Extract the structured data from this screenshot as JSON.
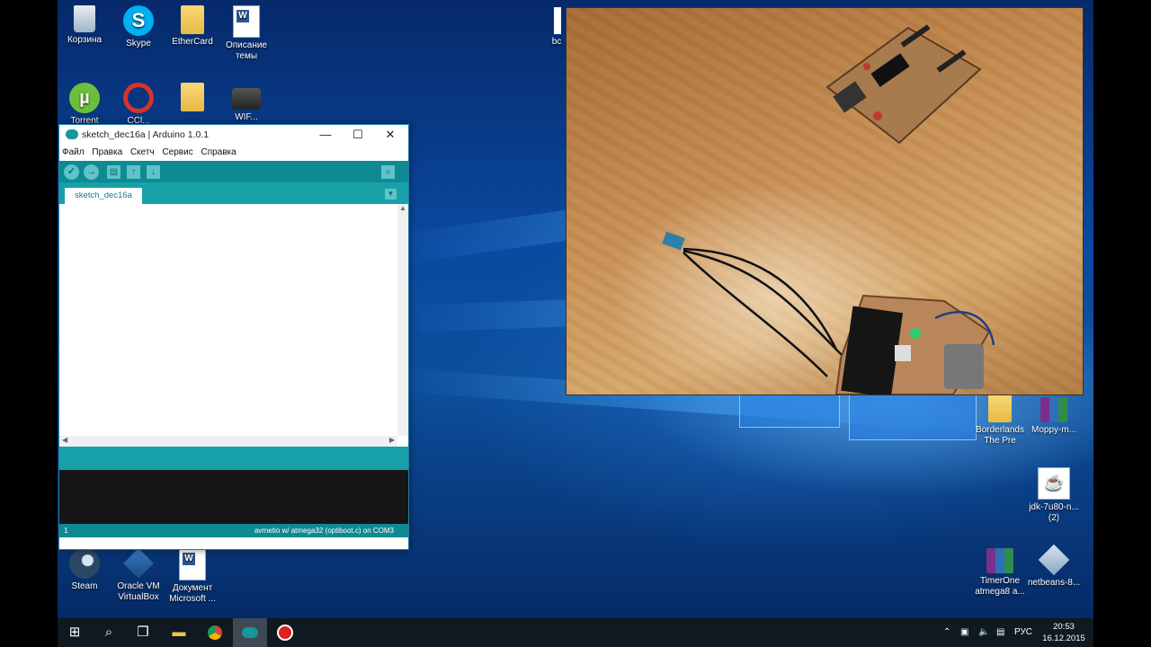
{
  "desktop_icons": [
    {
      "label": "Корзина",
      "icon": "recycle-bin-icon"
    },
    {
      "label": "Skype",
      "icon": "skype-icon"
    },
    {
      "label": "EtherCard",
      "icon": "folder-icon"
    },
    {
      "label": "Описание\nтемы",
      "icon": "word-document-icon"
    },
    {
      "label": "Torrent",
      "icon": "utorrent-icon"
    },
    {
      "label": "CCl...",
      "icon": "ccleaner-icon"
    },
    {
      "label": "",
      "icon": "folder-icon"
    },
    {
      "label": "WIF...",
      "icon": "camera-shortcut-icon"
    },
    {
      "label": "Steam",
      "icon": "steam-icon"
    },
    {
      "label": "Oracle VM\nVirtualBox",
      "icon": "virtualbox-icon"
    },
    {
      "label": "Документ\nMicrosoft ...",
      "icon": "word-document-icon"
    },
    {
      "label": "bc",
      "icon": "document-icon"
    },
    {
      "label": "Borderlands\nThe Pre",
      "icon": "folder-icon"
    },
    {
      "label": "Moppy-m...",
      "icon": "winrar-icon"
    },
    {
      "label": "jdk-7u80-n...\n(2)",
      "icon": "java-installer-icon"
    },
    {
      "label": "TimerOne\natmega8 a...",
      "icon": "winrar-icon"
    },
    {
      "label": "netbeans-8...",
      "icon": "netbeans-installer-icon"
    }
  ],
  "arduino": {
    "title": "sketch_dec16a | Arduino 1.0.1",
    "menu": [
      "Файл",
      "Правка",
      "Скетч",
      "Сервис",
      "Справка"
    ],
    "tab_label": "sketch_dec16a",
    "footer_line": "1",
    "footer_board": "avrnetio w/ atmega32 (optiboot.c) on COM3",
    "colors": {
      "teal": "#17a0a8",
      "dark_teal": "#0e8a92",
      "console": "#151515"
    }
  },
  "taskbar": {
    "clock_time": "20:53",
    "clock_date": "16.12.2015",
    "language": "РУС"
  }
}
